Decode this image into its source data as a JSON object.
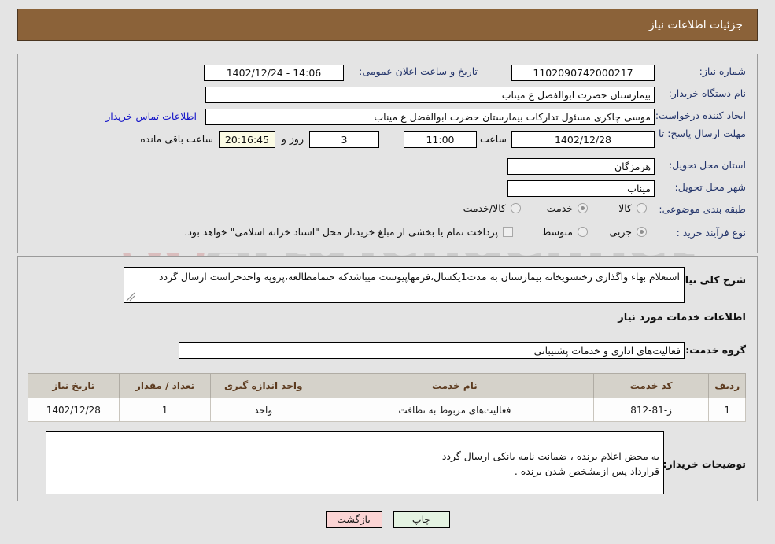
{
  "header": {
    "title": "جزئیات اطلاعات نیاز"
  },
  "colors": {
    "header_bg": "#8b6239",
    "page_bg": "#e4e4e4",
    "label": "#24356b",
    "link": "#1414c8",
    "table_header_bg": "#d5d2ca",
    "table_header_text": "#5c3a1e",
    "countdown_bg": "#fbfbe4",
    "print_button_bg": "#e4f3e2",
    "back_button_bg": "#fbd4d4"
  },
  "watermark": {
    "text": "ArtaTender.net"
  },
  "form": {
    "need_number": {
      "label": "شماره نیاز:",
      "value": "1102090742000217"
    },
    "announce_datetime": {
      "label": "تاریخ و ساعت اعلان عمومی:",
      "value": "14:06 - 1402/12/24"
    },
    "buyer_org": {
      "label": "نام دستگاه خریدار:",
      "value": "بیمارستان حضرت ابوالفضل ع  میناب"
    },
    "creator": {
      "label": "ایجاد کننده درخواست:",
      "value": "موسی چاکری مسئول تدارکات بیمارستان حضرت ابوالفضل ع  میناب"
    },
    "contact_link": {
      "label": "اطلاعات تماس خریدار"
    },
    "deadline": {
      "label": "مهلت ارسال پاسخ: تا تاریخ:",
      "date": "1402/12/28",
      "hour_label": "ساعت",
      "hour": "11:00",
      "days": "3",
      "days_label": "روز و",
      "countdown": "20:16:45",
      "remaining_label": "ساعت باقی مانده"
    },
    "province": {
      "label": "استان محل تحویل:",
      "value": "هرمزگان"
    },
    "city": {
      "label": "شهر محل تحویل:",
      "value": "میناب"
    },
    "category": {
      "label": "طبقه بندی موضوعی:",
      "options": [
        {
          "label": "کالا",
          "selected": false
        },
        {
          "label": "خدمت",
          "selected": true
        },
        {
          "label": "کالا/خدمت",
          "selected": false
        }
      ]
    },
    "purchase_type": {
      "label": "نوع فرآیند خرید :",
      "options": [
        {
          "label": "جزیی",
          "selected": true
        },
        {
          "label": "متوسط",
          "selected": false
        }
      ],
      "checkbox": {
        "label": "پرداخت تمام یا بخشی از مبلغ خرید،از محل \"اسناد خزانه اسلامی\" خواهد بود.",
        "checked": false
      }
    },
    "general_description": {
      "label": "شرح کلی نیاز:",
      "value": "استعلام بهاء واگذاری رختشویخانه بیمارستان به مدت1یکسال،فرمهاپیوست میباشدکه حتمامطالعه،پروپه واحدحراست ارسال گردد"
    },
    "services_section_title": "اطلاعات خدمات مورد نیاز",
    "service_group": {
      "label": "گروه خدمت:",
      "value": "فعالیت‌های اداری و خدمات پشتیبانی"
    },
    "buyer_notes": {
      "label": "توضیحات خریدار:",
      "value": "به محض اعلام برنده ، ضمانت نامه بانکی ارسال گردد\nقرارداد پس ازمشخص شدن برنده ."
    }
  },
  "services_table": {
    "columns": [
      "ردیف",
      "کد خدمت",
      "نام خدمت",
      "واحد اندازه گیری",
      "تعداد / مقدار",
      "تاریخ نیاز"
    ],
    "rows": [
      {
        "radif": "1",
        "code": "ز-81-812",
        "name": "فعالیت‌های مربوط به نظافت",
        "unit": "واحد",
        "qty": "1",
        "date": "1402/12/28"
      }
    ]
  },
  "footer": {
    "print_label": "چاپ",
    "back_label": "بازگشت"
  }
}
